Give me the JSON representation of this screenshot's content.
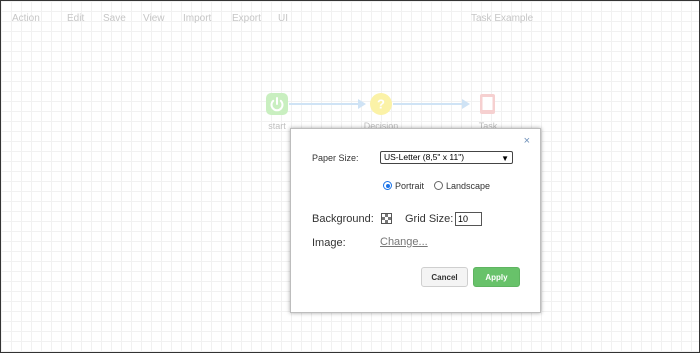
{
  "menu": {
    "action": "Action",
    "edit": "Edit",
    "save": "Save",
    "view": "View",
    "import": "Import",
    "export": "Export",
    "ui": "UI"
  },
  "app_title": "Task Example",
  "workflow": {
    "nodes": [
      {
        "label": "start",
        "icon": "power-icon",
        "color": "#c9efc0"
      },
      {
        "label": "Decision",
        "icon": "question-icon",
        "color": "#fbf2a7"
      },
      {
        "label": "Task",
        "icon": "document-icon",
        "color": "#f6d0d0"
      }
    ],
    "connector_color": "#cfe3f5"
  },
  "dialog": {
    "close_glyph": "×",
    "paper_size_label": "Paper Size:",
    "paper_size_value": "US-Letter (8,5\" x 11\")",
    "orientation_portrait": "Portrait",
    "orientation_landscape": "Landscape",
    "orientation_selected": "Portrait",
    "background_label": "Background:",
    "grid_size_label": "Grid Size:",
    "grid_size_value": "10",
    "image_label": "Image:",
    "change_link": "Change...",
    "cancel_label": "Cancel",
    "apply_label": "Apply",
    "apply_color": "#68c26a"
  }
}
